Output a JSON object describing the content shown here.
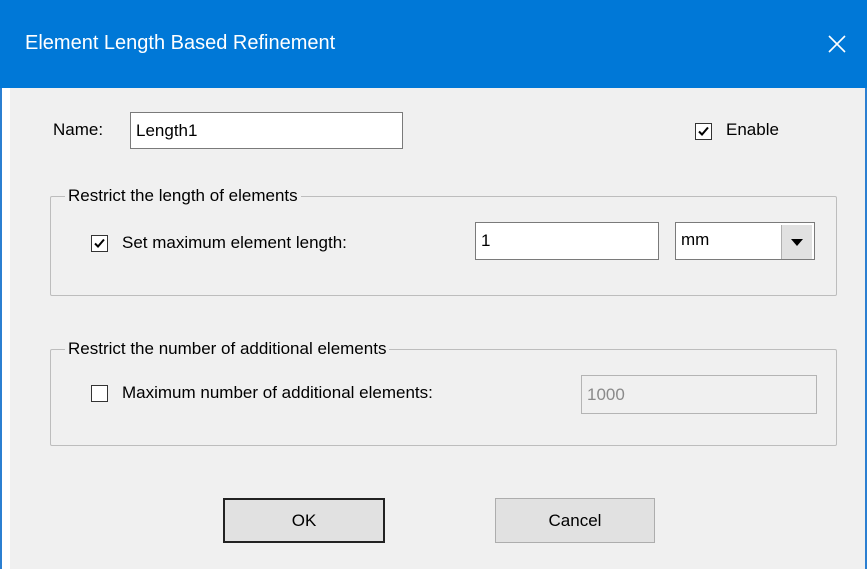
{
  "window": {
    "title": "Element Length Based Refinement"
  },
  "name_field": {
    "label": "Name:",
    "value": "Length1"
  },
  "enable": {
    "label": "Enable",
    "checked": true
  },
  "length_group": {
    "title": "Restrict the length of elements",
    "max_length_label": "Set maximum element length:",
    "max_length_checked": true,
    "max_length_value": "1",
    "unit_selected": "mm"
  },
  "count_group": {
    "title": "Restrict the number of additional elements",
    "max_count_label": "Maximum number of additional elements:",
    "max_count_checked": false,
    "max_count_value": "1000"
  },
  "buttons": {
    "ok": "OK",
    "cancel": "Cancel"
  },
  "icons": {
    "close": "close-icon",
    "check": "checkmark-icon",
    "dropdown": "dropdown-arrow-icon"
  }
}
